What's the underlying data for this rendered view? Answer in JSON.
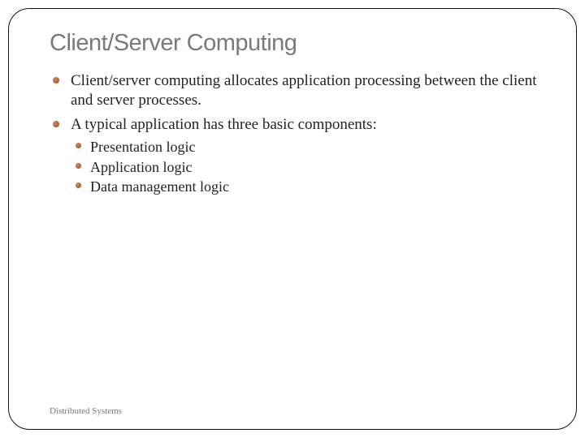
{
  "title": "Client/Server Computing",
  "bullets": {
    "b0": "Client/server computing allocates application processing between the client and server processes.",
    "b1": "A typical application has three basic components:",
    "sub": {
      "s0": "Presentation logic",
      "s1": "Application logic",
      "s2": "Data management logic"
    }
  },
  "footer": "Distributed Systems"
}
